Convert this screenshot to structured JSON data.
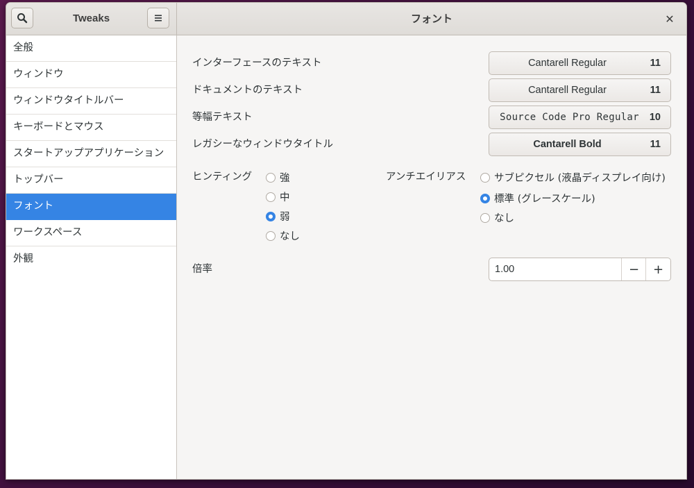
{
  "header": {
    "app_title": "Tweaks",
    "page_title": "フォント",
    "search_icon": "search-icon",
    "menu_icon": "hamburger-menu-icon",
    "close_icon": "close-icon",
    "close_glyph": "✕"
  },
  "sidebar": {
    "items": [
      {
        "label": "全般",
        "selected": false
      },
      {
        "label": "ウィンドウ",
        "selected": false
      },
      {
        "label": "ウィンドウタイトルバー",
        "selected": false
      },
      {
        "label": "キーボードとマウス",
        "selected": false
      },
      {
        "label": "スタートアップアプリケーション",
        "selected": false
      },
      {
        "label": "トップバー",
        "selected": false
      },
      {
        "label": "フォント",
        "selected": true
      },
      {
        "label": "ワークスペース",
        "selected": false
      },
      {
        "label": "外観",
        "selected": false
      }
    ]
  },
  "fonts": [
    {
      "label": "インターフェースのテキスト",
      "font": "Cantarell Regular",
      "size": "11"
    },
    {
      "label": "ドキュメントのテキスト",
      "font": "Cantarell Regular",
      "size": "11"
    },
    {
      "label": "等幅テキスト",
      "font": "Source Code Pro Regular",
      "size": "10"
    },
    {
      "label": "レガシーなウィンドウタイトル",
      "font": "Cantarell Bold",
      "size": "11"
    }
  ],
  "hinting": {
    "label": "ヒンティング",
    "options": [
      "強",
      "中",
      "弱",
      "なし"
    ],
    "selected": "弱"
  },
  "antialiasing": {
    "label": "アンチエイリアス",
    "options": [
      "サブピクセル (液晶ディスプレイ向け)",
      "標準 (グレースケール)",
      "なし"
    ],
    "selected": "標準 (グレースケール)"
  },
  "scaling": {
    "label": "倍率",
    "value": "1.00",
    "minus": "−",
    "plus": "+"
  },
  "colors": {
    "accent": "#3584e4",
    "window_bg": "#f6f5f4",
    "sidebar_bg": "#ffffff"
  }
}
